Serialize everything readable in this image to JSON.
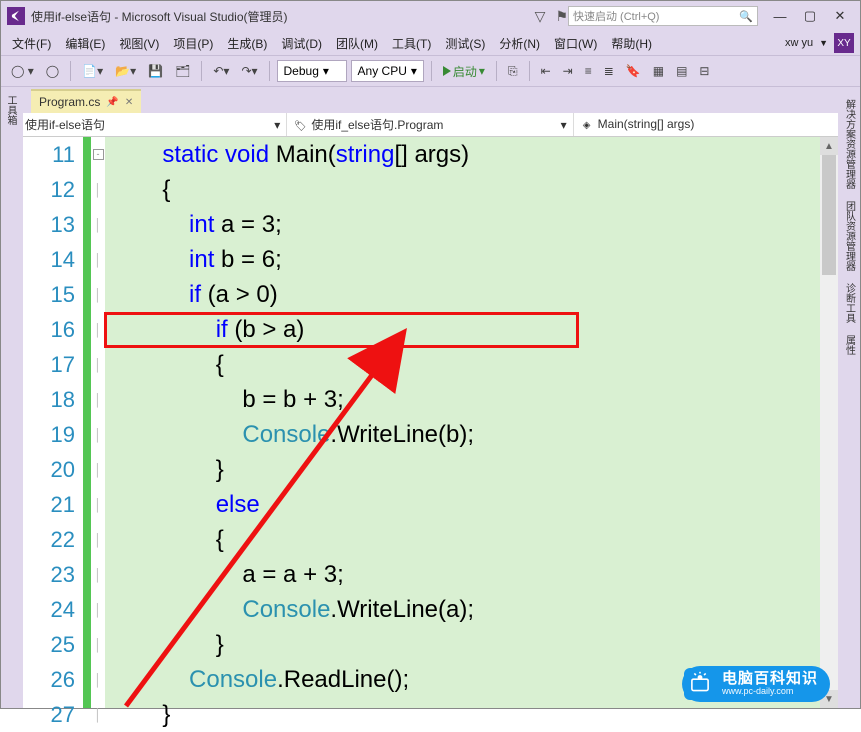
{
  "title": "使用if-else语句 - Microsoft Visual Studio(管理员)",
  "search_placeholder": "快速启动 (Ctrl+Q)",
  "menus": [
    "文件(F)",
    "编辑(E)",
    "视图(V)",
    "项目(P)",
    "生成(B)",
    "调试(D)",
    "团队(M)",
    "工具(T)",
    "测试(S)",
    "分析(N)",
    "窗口(W)",
    "帮助(H)"
  ],
  "user": {
    "name": "xw yu",
    "initials": "XY"
  },
  "toolbar": {
    "config": "Debug",
    "platform": "Any CPU",
    "start": "启动"
  },
  "tab": {
    "filename": "Program.cs"
  },
  "nav": {
    "left": "使用if-else语句",
    "mid": "使用if_else语句.Program",
    "right": "Main(string[] args)"
  },
  "leftrail": "工具箱",
  "rightrail": [
    "解决方案资源管理器",
    "团队资源管理器",
    "诊断工具",
    "属性"
  ],
  "code": {
    "lines": [
      {
        "n": 11,
        "fold": "box",
        "tokens": [
          {
            "t": "        ",
            "c": ""
          },
          {
            "t": "static",
            "c": "kw"
          },
          {
            "t": " ",
            "c": ""
          },
          {
            "t": "void",
            "c": "kw"
          },
          {
            "t": " Main(",
            "c": ""
          },
          {
            "t": "string",
            "c": "kw"
          },
          {
            "t": "[] args)",
            "c": ""
          }
        ]
      },
      {
        "n": 12,
        "tokens": [
          {
            "t": "        {",
            "c": ""
          }
        ]
      },
      {
        "n": 13,
        "tokens": [
          {
            "t": "            ",
            "c": ""
          },
          {
            "t": "int",
            "c": "kw"
          },
          {
            "t": " a = 3;",
            "c": ""
          }
        ]
      },
      {
        "n": 14,
        "tokens": [
          {
            "t": "            ",
            "c": ""
          },
          {
            "t": "int",
            "c": "kw"
          },
          {
            "t": " b = 6;",
            "c": ""
          }
        ]
      },
      {
        "n": 15,
        "tokens": [
          {
            "t": "            ",
            "c": ""
          },
          {
            "t": "if",
            "c": "kw"
          },
          {
            "t": " (a > 0)",
            "c": ""
          }
        ]
      },
      {
        "n": 16,
        "tokens": [
          {
            "t": "                ",
            "c": ""
          },
          {
            "t": "if",
            "c": "kw"
          },
          {
            "t": " (b > a)",
            "c": ""
          }
        ]
      },
      {
        "n": 17,
        "tokens": [
          {
            "t": "                {",
            "c": ""
          }
        ]
      },
      {
        "n": 18,
        "tokens": [
          {
            "t": "                    b = b + 3;",
            "c": ""
          }
        ]
      },
      {
        "n": 19,
        "tokens": [
          {
            "t": "                    ",
            "c": ""
          },
          {
            "t": "Console",
            "c": "typ"
          },
          {
            "t": ".WriteLine(b);",
            "c": ""
          }
        ]
      },
      {
        "n": 20,
        "tokens": [
          {
            "t": "                }",
            "c": ""
          }
        ]
      },
      {
        "n": 21,
        "tokens": [
          {
            "t": "                ",
            "c": ""
          },
          {
            "t": "else",
            "c": "kw"
          }
        ]
      },
      {
        "n": 22,
        "tokens": [
          {
            "t": "                {",
            "c": ""
          }
        ]
      },
      {
        "n": 23,
        "tokens": [
          {
            "t": "                    a = a + 3;",
            "c": ""
          }
        ]
      },
      {
        "n": 24,
        "tokens": [
          {
            "t": "                    ",
            "c": ""
          },
          {
            "t": "Console",
            "c": "typ"
          },
          {
            "t": ".WriteLine(a);",
            "c": ""
          }
        ]
      },
      {
        "n": 25,
        "tokens": [
          {
            "t": "                }",
            "c": ""
          }
        ]
      },
      {
        "n": 26,
        "tokens": [
          {
            "t": "            ",
            "c": ""
          },
          {
            "t": "Console",
            "c": "typ"
          },
          {
            "t": ".ReadLine();",
            "c": ""
          }
        ]
      },
      {
        "n": 27,
        "tokens": [
          {
            "t": "        }",
            "c": ""
          }
        ]
      }
    ]
  },
  "watermark": {
    "brand": "电脑百科知识",
    "url": "www.pc-daily.com"
  }
}
